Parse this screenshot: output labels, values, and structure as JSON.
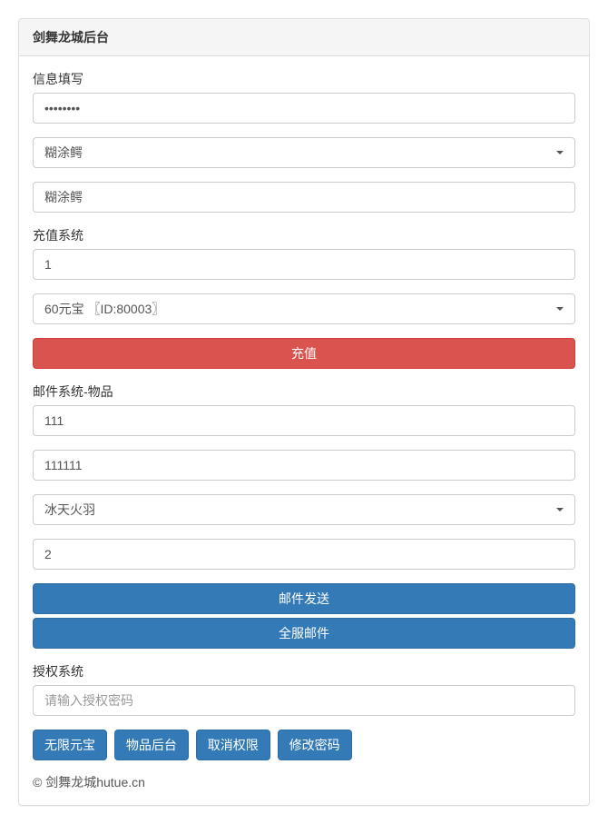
{
  "panel": {
    "title": "剑舞龙城后台"
  },
  "info_section": {
    "label": "信息填写",
    "password_value": "••••••••",
    "dropdown1_selected": "糊涂鳄",
    "account_value": "糊涂鳄"
  },
  "recharge_section": {
    "label": "充值系统",
    "quantity_value": "1",
    "dropdown_selected": "60元宝 〖ID:80003〗",
    "recharge_button": "充值"
  },
  "mail_section": {
    "label": "邮件系统-物品",
    "field1_value": "111",
    "field2_value": "111111",
    "dropdown_selected": "冰天火羽",
    "quantity_value": "2",
    "send_button": "邮件发送",
    "server_mail_button": "全服邮件"
  },
  "auth_section": {
    "label": "授权系统",
    "password_placeholder": "请输入授权密码"
  },
  "bottom_buttons": {
    "unlimited_gold": "无限元宝",
    "item_backend": "物品后台",
    "cancel_auth": "取消权限",
    "change_password": "修改密码"
  },
  "footer": {
    "text": "© 剑舞龙城hutue.cn"
  }
}
